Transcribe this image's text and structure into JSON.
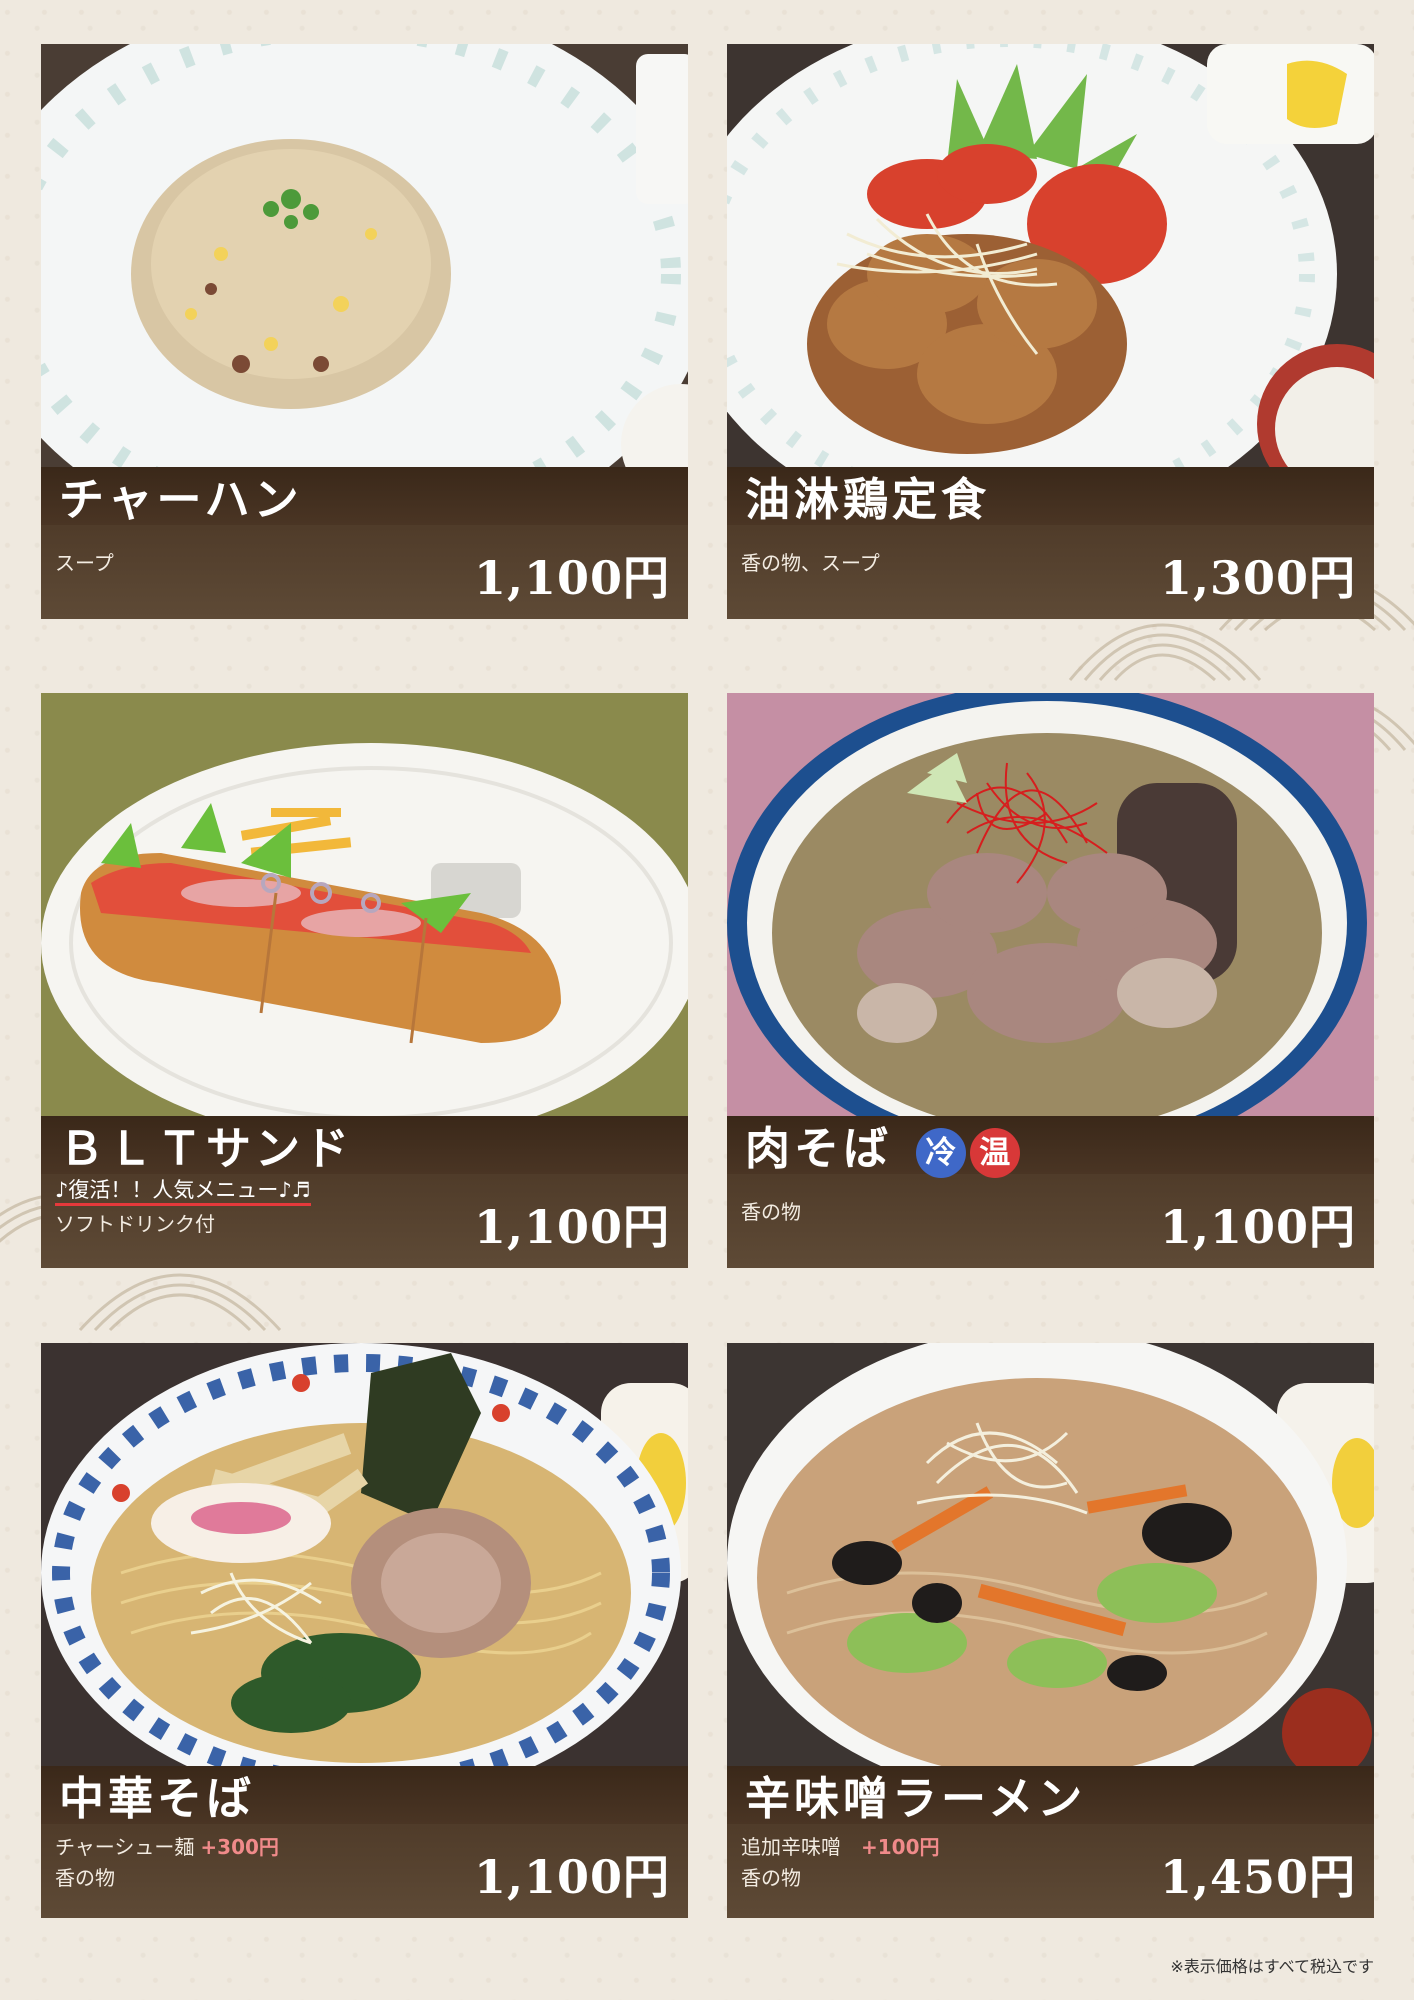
{
  "items": [
    {
      "name": "チャーハン",
      "sides": [
        "スープ"
      ],
      "price": "1,100円"
    },
    {
      "name": "油淋鶏定食",
      "sides": [
        "香の物、スープ"
      ],
      "price": "1,300円"
    },
    {
      "name": "ＢＬＴサンド",
      "tagline": "♪復活！！人気メニュー♪♬",
      "sides": [
        "ソフトドリンク付"
      ],
      "price": "1,100円"
    },
    {
      "name": "肉そば",
      "badges": [
        "冷",
        "温"
      ],
      "sides": [
        "香の物"
      ],
      "price": "1,100円"
    },
    {
      "name": "中華そば",
      "upgrade": {
        "label": "チャーシュー麺",
        "price": "+300円"
      },
      "sides": [
        "香の物"
      ],
      "price": "1,100円"
    },
    {
      "name": "辛味噌ラーメン",
      "upgrade": {
        "label": "追加辛味噌",
        "price": "+100円"
      },
      "sides": [
        "香の物"
      ],
      "price": "1,450円"
    }
  ],
  "footnote": "※表示価格はすべて税込です",
  "colors": {
    "background": "#efe9df",
    "panel": "#4f3b29",
    "cold_badge": "#3f68c8",
    "hot_badge": "#d83838",
    "upgrade_price": "#f08a8a"
  }
}
